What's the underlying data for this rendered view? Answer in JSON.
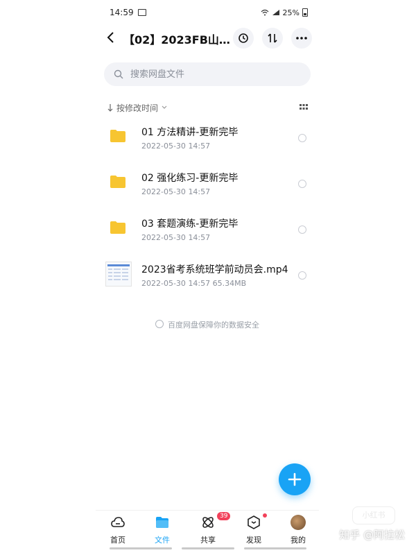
{
  "status": {
    "time": "14:59",
    "battery": "25%"
  },
  "header": {
    "title": "【02】2023FB山…"
  },
  "search": {
    "placeholder": "搜索网盘文件"
  },
  "sort": {
    "label": "按修改时间"
  },
  "files": [
    {
      "name": "01 方法精讲-更新完毕",
      "date": "2022-05-30",
      "time": "14:57",
      "size": "",
      "icon": "folder-icon"
    },
    {
      "name": "02 强化练习-更新完毕",
      "date": "2022-05-30",
      "time": "14:57",
      "size": "",
      "icon": "folder-icon"
    },
    {
      "name": "03 套题演练-更新完毕",
      "date": "2022-05-30",
      "time": "14:57",
      "size": "",
      "icon": "folder-icon"
    },
    {
      "name": "2023省考系统班学前动员会.mp4",
      "date": "2022-05-30",
      "time": "14:57",
      "size": "65.34MB",
      "icon": "video-thumbnail"
    }
  ],
  "footer_note": "百度网盘保障你的数据安全",
  "tabs": [
    {
      "label": "首页",
      "icon": "cloud-icon"
    },
    {
      "label": "文件",
      "icon": "folder-tab-icon",
      "active": true
    },
    {
      "label": "共享",
      "icon": "share-icon",
      "badge": "39"
    },
    {
      "label": "发现",
      "icon": "discover-icon"
    },
    {
      "label": "我的",
      "icon": "avatar"
    }
  ],
  "watermark": "知乎 @阿拉松",
  "watermark2": "小红书",
  "colors": {
    "accent": "#19a3f5",
    "badge": "#f2415a",
    "folder": "#f7c531"
  }
}
